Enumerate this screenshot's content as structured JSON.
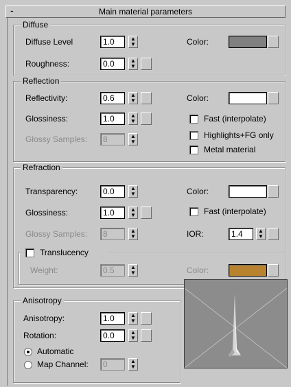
{
  "rollout": {
    "title": "Main material parameters",
    "collapse": "-"
  },
  "diffuse": {
    "group_title": "Diffuse",
    "level_label": "Diffuse Level",
    "level_value": "1.0",
    "roughness_label": "Roughness:",
    "roughness_value": "0.0",
    "color_label": "Color:",
    "color_hex": "#808080"
  },
  "reflection": {
    "group_title": "Reflection",
    "reflectivity_label": "Reflectivity:",
    "reflectivity_value": "0.6",
    "glossiness_label": "Glossiness:",
    "glossiness_value": "1.0",
    "samples_label": "Glossy Samples:",
    "samples_value": "8",
    "color_label": "Color:",
    "color_hex": "#ffffff",
    "fast_label": "Fast (interpolate)",
    "highlights_label": "Highlights+FG only",
    "metal_label": "Metal material"
  },
  "refraction": {
    "group_title": "Refraction",
    "transparency_label": "Transparency:",
    "transparency_value": "0.0",
    "glossiness_label": "Glossiness:",
    "glossiness_value": "1.0",
    "samples_label": "Glossy Samples:",
    "samples_value": "8",
    "color_label": "Color:",
    "color_hex": "#ffffff",
    "fast_label": "Fast (interpolate)",
    "ior_label": "IOR:",
    "ior_value": "1.4"
  },
  "translucency": {
    "label": "Translucency",
    "weight_label": "Weight:",
    "weight_value": "0.5",
    "color_label": "Color:",
    "color_hex": "#b8822e"
  },
  "anisotropy": {
    "group_title": "Anisotropy",
    "anisotropy_label": "Anisotropy:",
    "anisotropy_value": "1.0",
    "rotation_label": "Rotation:",
    "rotation_value": "0.0",
    "automatic_label": "Automatic",
    "map_channel_label": "Map Channel:",
    "map_channel_value": "0"
  }
}
